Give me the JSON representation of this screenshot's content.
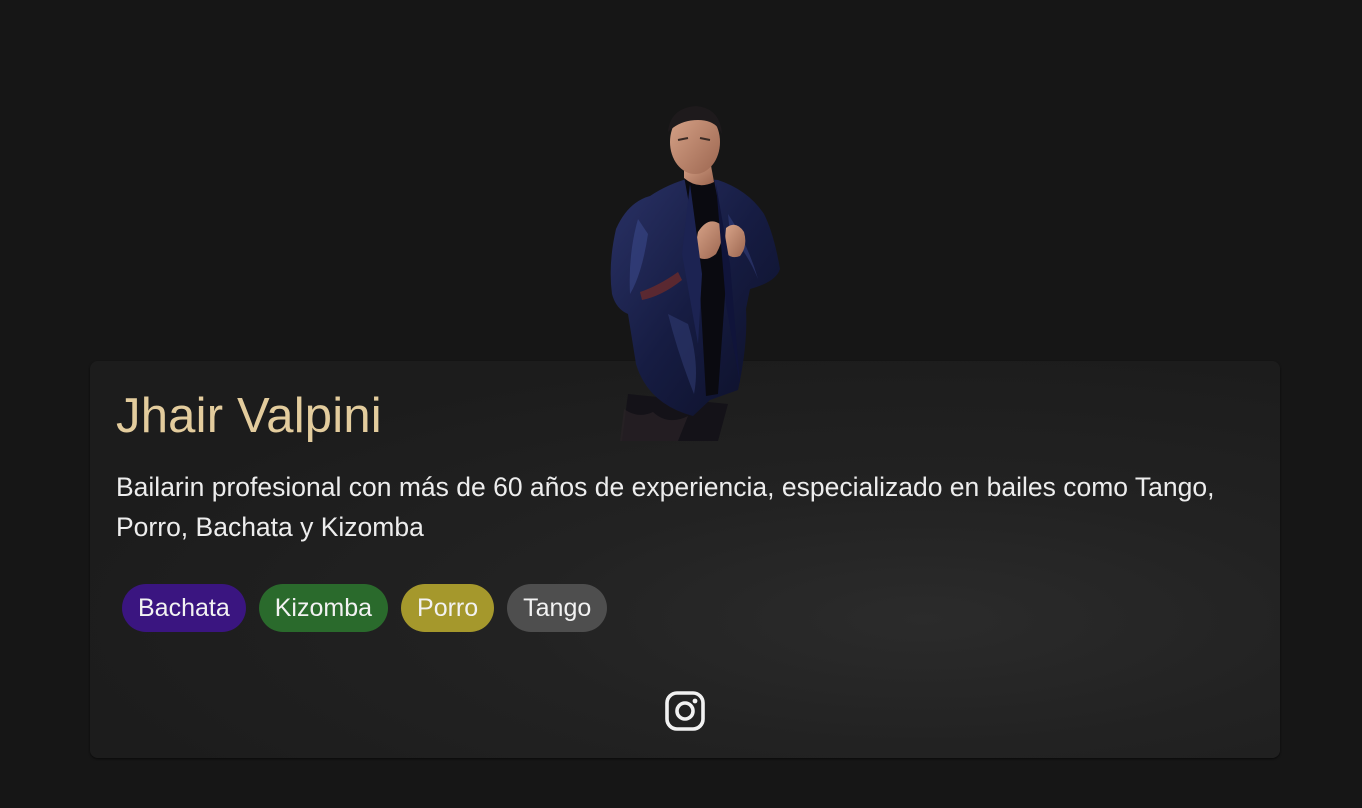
{
  "profile": {
    "name": "Jhair Valpini",
    "bio": "Bailarin profesional con más de 60 años de experiencia, especializado en bailes como Tango, Porro, Bachata y Kizomba",
    "photo_icon": "dancer-portrait"
  },
  "tags": [
    {
      "label": "Bachata",
      "color": "#3a1580"
    },
    {
      "label": "Kizomba",
      "color": "#2a6a2c"
    },
    {
      "label": "Porro",
      "color": "#a5982c"
    },
    {
      "label": "Tango",
      "color": "#4e4e4e"
    }
  ],
  "social": {
    "instagram_icon": "instagram-icon"
  },
  "colors": {
    "background": "#161616",
    "card": "#222222",
    "name": "#e3cc9d",
    "text": "#ededed"
  }
}
